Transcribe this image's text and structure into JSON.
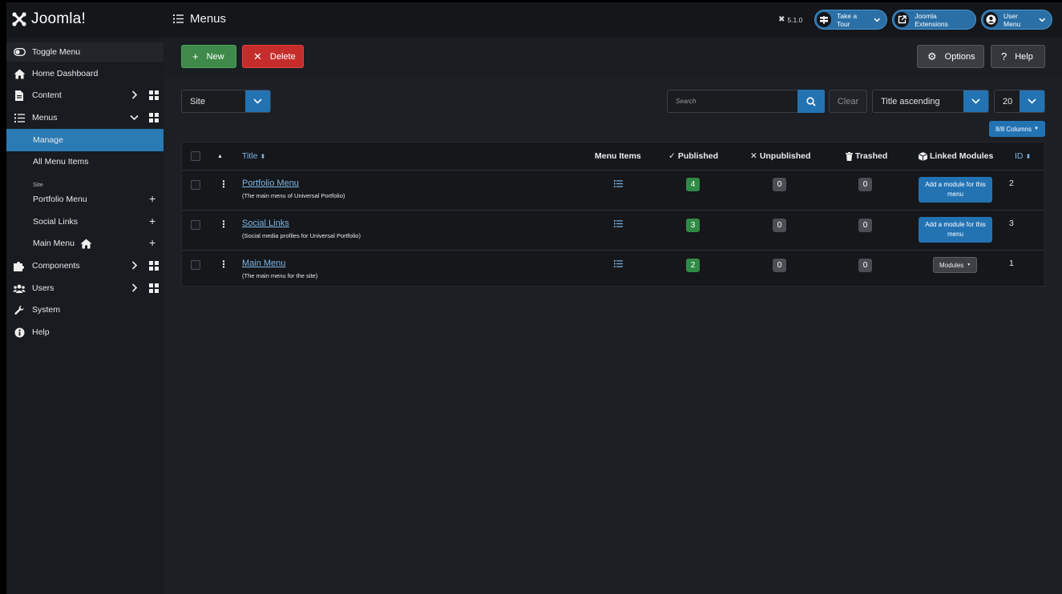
{
  "header": {
    "logo_text": "Joomla!",
    "page_title": "Menus",
    "version": "5.1.0",
    "take_tour": "Take a Tour",
    "extensions": "Joomla Extensions",
    "user_menu": "User Menu"
  },
  "sidebar": {
    "toggle": "Toggle Menu",
    "home": "Home Dashboard",
    "content": "Content",
    "menus": "Menus",
    "manage": "Manage",
    "all_items": "All Menu Items",
    "site_heading": "Site",
    "portfolio_menu": "Portfolio Menu",
    "social_links": "Social Links",
    "main_menu": "Main Menu",
    "components": "Components",
    "users": "Users",
    "system": "System",
    "help": "Help"
  },
  "toolbar": {
    "new": "New",
    "delete": "Delete",
    "options": "Options",
    "help": "Help"
  },
  "filters": {
    "client": "Site",
    "search_placeholder": "Search",
    "clear": "Clear",
    "ordering": "Title ascending",
    "limit": "20",
    "columns": "8/8 Columns"
  },
  "table": {
    "headers": {
      "title": "Title",
      "menu_items": "Menu Items",
      "published": "Published",
      "unpublished": "Unpublished",
      "trashed": "Trashed",
      "linked_modules": "Linked Modules",
      "id": "ID"
    },
    "rows": [
      {
        "title": "Portfolio Menu",
        "desc": "(The main menu of Universal Portfolio)",
        "published": "4",
        "unpublished": "0",
        "trashed": "0",
        "module": "Add a module for this menu",
        "id": "2"
      },
      {
        "title": "Social Links",
        "desc": "(Social media profiles for Universal Portfolio)",
        "published": "3",
        "unpublished": "0",
        "trashed": "0",
        "module": "Add a module for this menu",
        "id": "3"
      },
      {
        "title": "Main Menu",
        "desc": "(The main menu for the site)",
        "published": "2",
        "unpublished": "0",
        "trashed": "0",
        "module": "Modules",
        "id": "1"
      }
    ]
  },
  "colors": {
    "accent": "#2373b3",
    "success": "#3f8a4b",
    "danger": "#c52d2d"
  }
}
